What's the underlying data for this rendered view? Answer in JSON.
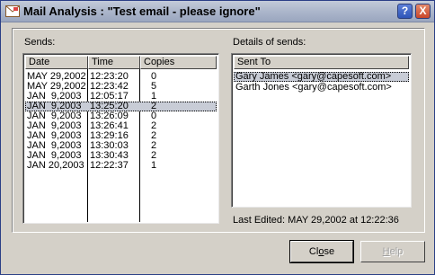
{
  "window": {
    "title": "Mail Analysis : \"Test email - please ignore\"",
    "help_glyph": "?",
    "close_glyph": "X"
  },
  "sends": {
    "label": "Sends:",
    "columns": [
      "Date",
      "Time",
      "Copies"
    ],
    "rows": [
      {
        "date": "MAY 29,2002",
        "time": "12:23:20",
        "copies": "0"
      },
      {
        "date": "MAY 29,2002",
        "time": "12:23:42",
        "copies": "5"
      },
      {
        "date": "JAN  9,2003",
        "time": "12:05:17",
        "copies": "1"
      },
      {
        "date": "JAN  9,2003",
        "time": "13:25:20",
        "copies": "2"
      },
      {
        "date": "JAN  9,2003",
        "time": "13:26:09",
        "copies": "0"
      },
      {
        "date": "JAN  9,2003",
        "time": "13:26:41",
        "copies": "2"
      },
      {
        "date": "JAN  9,2003",
        "time": "13:29:16",
        "copies": "2"
      },
      {
        "date": "JAN  9,2003",
        "time": "13:30:03",
        "copies": "2"
      },
      {
        "date": "JAN  9,2003",
        "time": "13:30:43",
        "copies": "2"
      },
      {
        "date": "JAN 20,2003",
        "time": "12:22:37",
        "copies": "1"
      }
    ],
    "selected_index": 3
  },
  "details": {
    "label": "Details of sends:",
    "column": "Sent To",
    "rows": [
      "Gary James <gary@capesoft.com>",
      "Garth Jones <gary@capesoft.com>"
    ],
    "selected_index": 0,
    "last_edited": "Last Edited: MAY 29,2002 at 12:22:36"
  },
  "buttons": {
    "close_pre": "Cl",
    "close_accel": "o",
    "close_post": "se",
    "help_accel": "H",
    "help_post": "elp"
  },
  "colors": {
    "selection": "#c8ccd6",
    "face": "#d4d0c8"
  }
}
